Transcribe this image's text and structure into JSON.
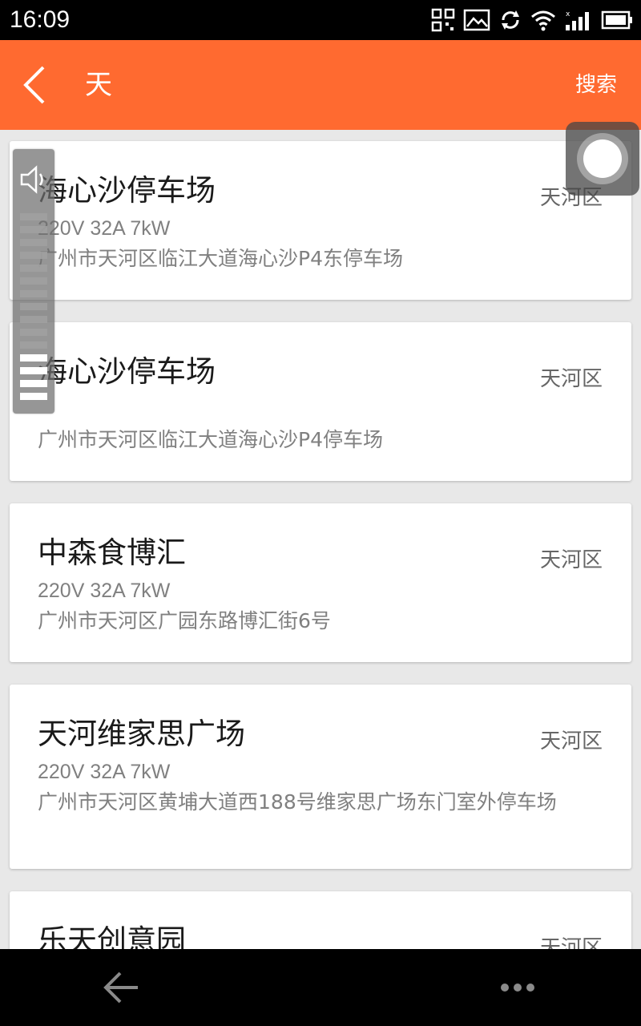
{
  "status_bar": {
    "time": "16:09",
    "icons": [
      "qr-code-icon",
      "gallery-icon",
      "sync-icon",
      "wifi-icon",
      "cellular-signal-icon",
      "battery-icon"
    ]
  },
  "app_bar": {
    "back_icon": "chevron-left-icon",
    "title": "天",
    "search_label": "搜索",
    "background_color": "#ff6a30"
  },
  "stations": [
    {
      "name": "海心沙停车场",
      "district": "天河区",
      "spec": "220V 32A 7kW",
      "address": "广州市天河区临江大道海心沙P4东停车场"
    },
    {
      "name": "海心沙停车场",
      "district": "天河区",
      "spec": "",
      "address": "广州市天河区临江大道海心沙P4停车场"
    },
    {
      "name": "中森食博汇",
      "district": "天河区",
      "spec": "220V 32A 7kW",
      "address": "广州市天河区广园东路博汇街6号"
    },
    {
      "name": "天河维家思广场",
      "district": "天河区",
      "spec": "220V 32A 7kW",
      "address": "广州市天河区黄埔大道西188号维家思广场东门室外停车场"
    },
    {
      "name": "乐天创意园",
      "district": "天河区",
      "spec": "",
      "address": ""
    }
  ],
  "volume_overlay": {
    "icon": "speaker-icon",
    "level_fraction": 0.27
  },
  "nav_bar": {
    "back_icon": "arrow-left-icon",
    "menu_icon": "more-dots-icon"
  }
}
